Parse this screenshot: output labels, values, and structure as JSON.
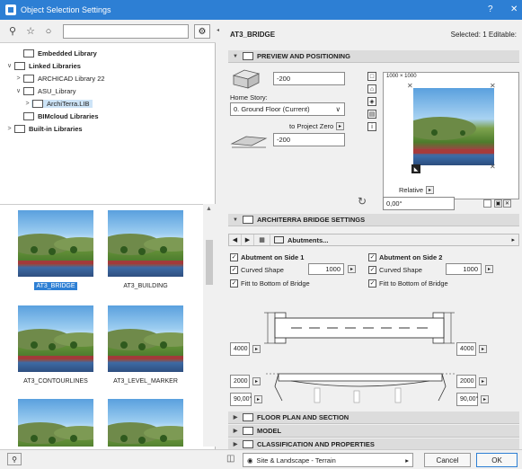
{
  "window": {
    "title": "Object Selection Settings",
    "help": "?",
    "close": "✕"
  },
  "library": {
    "search_placeholder": "",
    "tree": [
      {
        "label": "Embedded Library",
        "bold": true,
        "indent": 1,
        "chev": ""
      },
      {
        "label": "Linked Libraries",
        "bold": true,
        "indent": 0,
        "chev": "∨"
      },
      {
        "label": "ARCHICAD Library 22",
        "bold": false,
        "indent": 1,
        "chev": ">"
      },
      {
        "label": "ASU_Library",
        "bold": false,
        "indent": 1,
        "chev": "∨"
      },
      {
        "label": "ArchiTerra.LIB",
        "bold": false,
        "indent": 2,
        "chev": ">",
        "selected": true
      },
      {
        "label": "BIMcloud Libraries",
        "bold": true,
        "indent": 1,
        "chev": ""
      },
      {
        "label": "Built-in Libraries",
        "bold": true,
        "indent": 0,
        "chev": ">"
      }
    ],
    "thumbs": [
      {
        "label": "AT3_BRIDGE",
        "selected": true
      },
      {
        "label": "AT3_BUILDING",
        "selected": false
      },
      {
        "label": "AT3_CONTOURLINES",
        "selected": false
      },
      {
        "label": "AT3_LEVEL_MARKER",
        "selected": false
      },
      {
        "label": "",
        "selected": false
      },
      {
        "label": "",
        "selected": false
      }
    ]
  },
  "header": {
    "object_name": "AT3_BRIDGE",
    "selected_info": "Selected: 1 Editable:"
  },
  "preview_section": {
    "title": "PREVIEW AND POSITIONING",
    "height_value": "-200",
    "home_story_label": "Home Story:",
    "home_story_value": "0. Ground Floor (Current)",
    "to_project_zero_label": "to Project Zero",
    "project_zero_value": "-200",
    "preview_size": "1000 × 1000",
    "relative_label": "Relative",
    "angle_value": "0,00°"
  },
  "bridge_section": {
    "title": "ARCHITERRA BRIDGE SETTINGS",
    "page_label": "Abutments...",
    "side1": {
      "label": "Abutment on Side 1",
      "curved": "Curved Shape",
      "curved_value": "1000",
      "fit": "Fitt to Bottom of Bridge"
    },
    "side2": {
      "label": "Abutment on Side 2",
      "curved": "Curved Shape",
      "curved_value": "1000",
      "fit": "Fitt to Bottom of Bridge"
    },
    "dims": {
      "left_width": "4000",
      "right_width": "4000",
      "left_height": "2000",
      "right_height": "2000",
      "left_angle": "90,00°",
      "right_angle": "90,00°"
    }
  },
  "collapsed_sections": [
    "FLOOR PLAN AND SECTION",
    "MODEL",
    "CLASSIFICATION AND PROPERTIES"
  ],
  "footer": {
    "layer": "Site & Landscape - Terrain",
    "cancel": "Cancel",
    "ok": "OK"
  },
  "colors": {
    "accent": "#2d7fd4"
  }
}
